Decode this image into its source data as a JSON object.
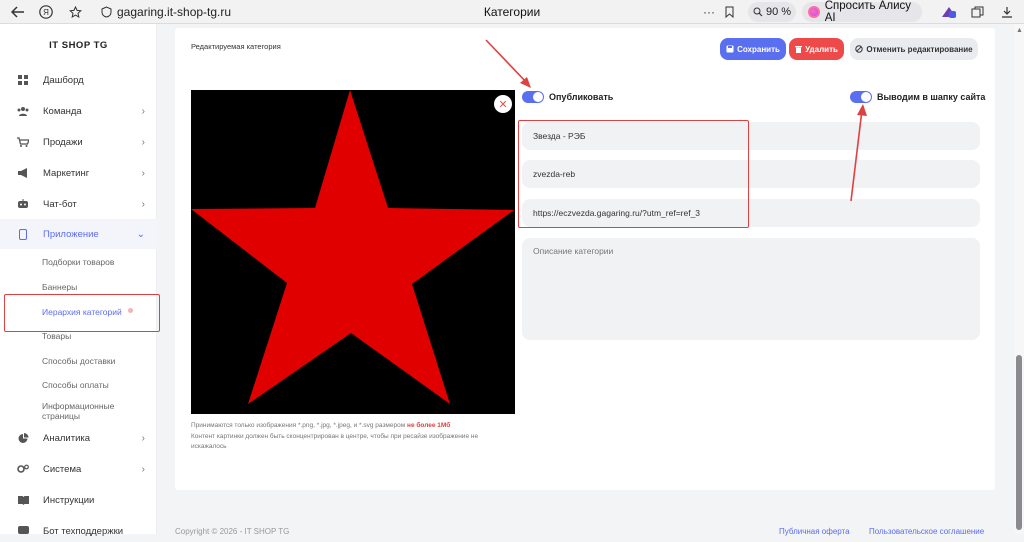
{
  "browser": {
    "url": "gagaring.it-shop-tg.ru",
    "tab_title": "Категории",
    "zoom": "90 %",
    "alice_label": "Спросить Алису AI",
    "more": "···"
  },
  "sidebar": {
    "brand": "IT SHOP TG",
    "items": [
      {
        "label": "Дашборд",
        "icon": "grid-icon"
      },
      {
        "label": "Команда",
        "icon": "users-icon"
      },
      {
        "label": "Продажи",
        "icon": "cart-icon"
      },
      {
        "label": "Маркетинг",
        "icon": "megaphone-icon"
      },
      {
        "label": "Чат-бот",
        "icon": "bot-icon"
      },
      {
        "label": "Приложение",
        "icon": "phone-icon"
      },
      {
        "label": "Аналитика",
        "icon": "chart-icon"
      },
      {
        "label": "Система",
        "icon": "gears-icon"
      },
      {
        "label": "Инструкции",
        "icon": "book-icon"
      },
      {
        "label": "Бот техподдержки",
        "icon": "support-icon"
      }
    ],
    "subitems": [
      "Подборки товаров",
      "Баннеры",
      "Иерархия категорий",
      "Товары",
      "Способы доставки",
      "Способы оплаты",
      "Информационные страницы"
    ]
  },
  "main": {
    "title": "Редактируемая категория",
    "buttons": {
      "save": "Сохранить",
      "delete": "Удалить",
      "cancel": "Отменить редактирование"
    },
    "toggles": {
      "publish": "Опубликовать",
      "header": "Выводим в шапку сайта"
    },
    "fields": {
      "name": "Звезда - РЭБ",
      "slug": "zvezda-reb",
      "link": "https://eczvezda.gagaring.ru/?utm_ref=ref_3",
      "description_placeholder": "Описание категории"
    },
    "hint_prefix": "Принимаются только изображения *.png, *.jpg, *.jpeg, и *.svg размером",
    "hint_limit": "не более 1Мб",
    "hint_line2": "Контент картинки должен быть сконцентрирован в центре, чтобы при ресайзе изображение не искажалось"
  },
  "footer": {
    "copyright": "Copyright © 2026 - IT SHOP TG",
    "offer": "Публичная оферта",
    "privacy": "Пользовательское соглашение"
  },
  "colors": {
    "accent": "#5a6ff0",
    "danger": "#ee4a4a",
    "annotation": "#e0403f",
    "star": "#e00000"
  }
}
